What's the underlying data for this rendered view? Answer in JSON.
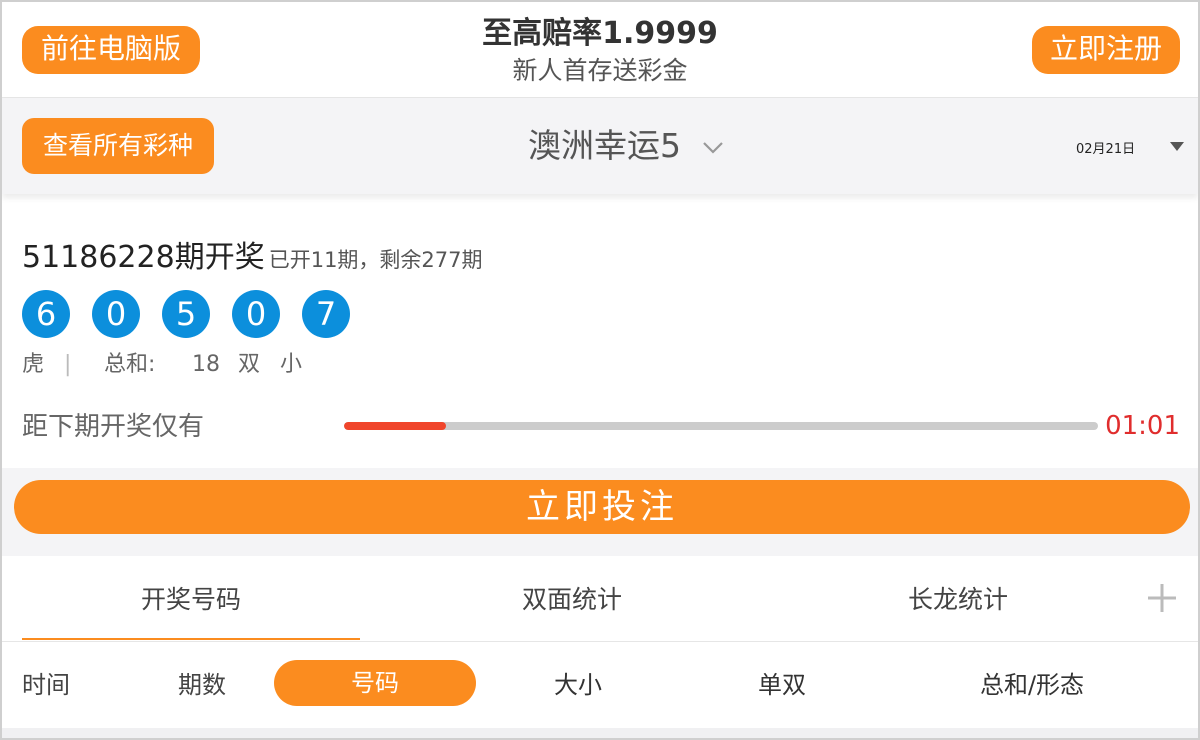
{
  "header": {
    "pc_version_label": "前往电脑版",
    "promo_title": "至高赔率1.9999",
    "promo_subtitle": "新人首存送彩金",
    "register_label": "立即注册"
  },
  "selector": {
    "all_lotteries_label": "查看所有彩种",
    "lottery_name": "澳洲幸运5",
    "date": "02月21日"
  },
  "draw": {
    "issue": "51186228期开奖",
    "progress_text": "已开11期，剩余277期",
    "numbers": [
      "6",
      "0",
      "5",
      "0",
      "7"
    ],
    "dragon_tiger": "虎",
    "separator": "|",
    "sum_label": "总和:",
    "sum_value": "18",
    "odd_even": "双",
    "big_small": "小",
    "countdown_label": "距下期开奖仅有",
    "countdown_time": "01:01",
    "countdown_progress": 0.135
  },
  "bet": {
    "label": "立即投注"
  },
  "tabs": [
    {
      "label": "开奖号码",
      "active": true
    },
    {
      "label": "双面统计",
      "active": false
    },
    {
      "label": "长龙统计",
      "active": false
    }
  ],
  "columns": {
    "time": "时间",
    "period": "期数",
    "number": "号码",
    "size": "大小",
    "odd_even": "单双",
    "sum_shape": "总和/形态"
  },
  "colors": {
    "accent_orange": "#fb8c1f",
    "ball_blue": "#0c8fdc",
    "countdown_red": "#e02d2d",
    "progress_red": "#f0452b"
  },
  "icons": {
    "dropdown": "chevron-down-icon",
    "date_caret": "caret-down-icon",
    "more_tabs": "plus-icon"
  }
}
